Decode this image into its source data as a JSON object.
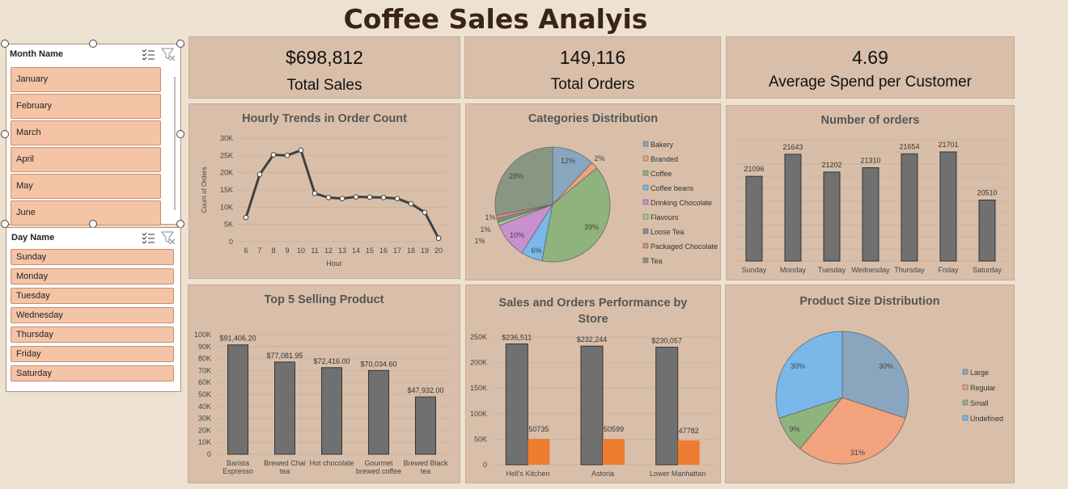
{
  "dashboard_title": "Coffee Sales Analyis",
  "slicers": {
    "month": {
      "title": "Month Name",
      "items": [
        "January",
        "February",
        "March",
        "April",
        "May",
        "June"
      ]
    },
    "day": {
      "title": "Day Name",
      "items": [
        "Sunday",
        "Monday",
        "Tuesday",
        "Wednesday",
        "Thursday",
        "Friday",
        "Saturday"
      ]
    }
  },
  "kpis": [
    {
      "value": "$698,812",
      "label": "Total Sales"
    },
    {
      "value": "149,116",
      "label": "Total Orders"
    },
    {
      "value": "4.69",
      "label": "Average Spend per Customer"
    }
  ],
  "colors": {
    "bar": "#707070",
    "orange": "#ed7d31",
    "card": "#d9bfa9"
  },
  "chart_data": [
    {
      "type": "line",
      "title": "Hourly Trends in Order Count",
      "xlabel": "Hour",
      "ylabel": "Count of Orders",
      "x": [
        6,
        7,
        8,
        9,
        10,
        11,
        12,
        13,
        14,
        15,
        16,
        17,
        18,
        19,
        20
      ],
      "values": [
        7000,
        19500,
        25200,
        25000,
        26500,
        14000,
        12800,
        12500,
        13000,
        12900,
        12800,
        12500,
        11000,
        8500,
        1000
      ],
      "yticks": [
        "0",
        "5K",
        "10K",
        "15K",
        "20K",
        "25K",
        "30K"
      ],
      "ylim": [
        0,
        30000
      ],
      "grid": true
    },
    {
      "type": "pie",
      "title": "Categories Distribution",
      "legend": [
        "Bakery",
        "Branded",
        "Coffee",
        "Coffee beans",
        "Drinking Chocolate",
        "Flavours",
        "Loose Tea",
        "Packaged Chocolate",
        "Tea"
      ],
      "colors": [
        "#8aa6bf",
        "#f2a27d",
        "#8fb37d",
        "#79b8e8",
        "#c98fcf",
        "#9fcf7a",
        "#7d8fa8",
        "#d98c6e",
        "#8a9684"
      ],
      "values": [
        12,
        2,
        39,
        6,
        10,
        1,
        1,
        1,
        28
      ],
      "labels": [
        "12%",
        "2%",
        "39%",
        "6%",
        "10%",
        "1%",
        "1%",
        "1%",
        "28%"
      ],
      "legend_position": "right"
    },
    {
      "type": "bar",
      "title": "Number of orders",
      "categories": [
        "Sunday",
        "Monday",
        "Tuesday",
        "Wednesday",
        "Thursday",
        "Friday",
        "Saturday"
      ],
      "values": [
        21096,
        21643,
        21202,
        21310,
        21654,
        21701,
        20510
      ],
      "labels": [
        "21096",
        "21643",
        "21202",
        "21310",
        "21654",
        "21701",
        "20510"
      ],
      "grid": true
    },
    {
      "type": "bar",
      "title": "Top 5 Selling Product",
      "categories": [
        [
          "Barista",
          "Espresso"
        ],
        [
          "Brewed Chai",
          "tea"
        ],
        [
          "Hot chocolate"
        ],
        [
          "Gourmet",
          "brewed coffee"
        ],
        [
          "Brewed Black",
          "tea"
        ]
      ],
      "values": [
        91406.2,
        77081.95,
        72416.0,
        70034.6,
        47932.0
      ],
      "labels": [
        "$91,406.20",
        "$77,081.95",
        "$72,416.00",
        "$70,034.60",
        "$47,932.00"
      ],
      "yticks": [
        "0",
        "10K",
        "20K",
        "30K",
        "40K",
        "50K",
        "60K",
        "70K",
        "80K",
        "90K",
        "100K"
      ],
      "ylim": [
        0,
        100000
      ],
      "grid": true
    },
    {
      "type": "bar",
      "title": "Sales and Orders Performance by Store",
      "categories": [
        "Hell's Kitchen",
        "Astoria",
        "Lower Manhattan"
      ],
      "series": [
        {
          "values": [
            236511,
            232244,
            230057
          ],
          "labels": [
            "$236,511",
            "$232,244",
            "$230,057"
          ]
        },
        {
          "values": [
            50735,
            50599,
            47782
          ],
          "labels": [
            "50735",
            "50599",
            "47782"
          ]
        }
      ],
      "yticks": [
        "0",
        "50K",
        "100K",
        "150K",
        "200K",
        "250K"
      ],
      "ylim": [
        0,
        250000
      ],
      "grid": true
    },
    {
      "type": "pie",
      "title": "Product Size Distribution",
      "legend": [
        "Large",
        "Regular",
        "Small",
        "Undefined"
      ],
      "colors": [
        "#8aa6bf",
        "#f2a27d",
        "#8fb37d",
        "#79b8e8"
      ],
      "values": [
        30,
        31,
        9,
        30
      ],
      "labels": [
        "30%",
        "31%",
        "9%",
        "30%"
      ],
      "legend_position": "right"
    }
  ]
}
